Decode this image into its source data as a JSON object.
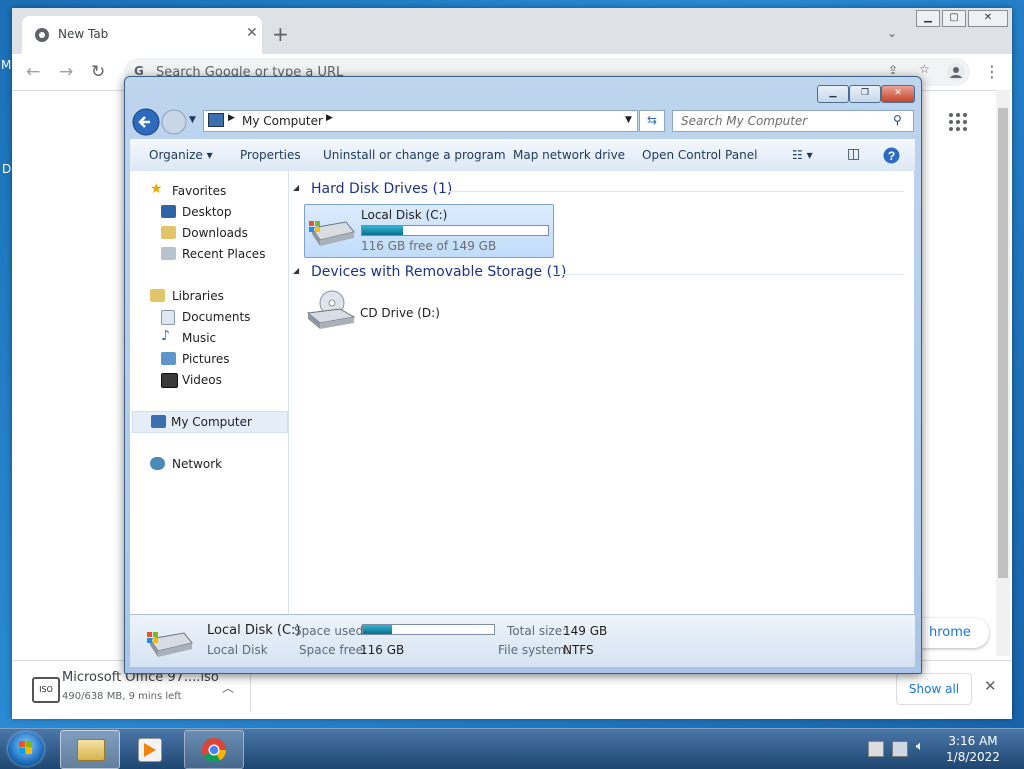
{
  "chrome": {
    "tab_title": "New Tab",
    "omnibox_placeholder": "Search Google or type a URL",
    "customize_label": "hrome"
  },
  "download": {
    "filename": "Microsoft Office 97....iso",
    "status": "490/638 MB, 9 mins left",
    "icon_text": "ISO",
    "show_all": "Show all"
  },
  "explorer": {
    "breadcrumb": "My Computer",
    "search_placeholder": "Search My Computer",
    "commands": [
      "Organize",
      "Properties",
      "Uninstall or change a program",
      "Map network drive",
      "Open Control Panel"
    ],
    "nav": {
      "favorites": "Favorites",
      "favorites_items": [
        "Desktop",
        "Downloads",
        "Recent Places"
      ],
      "libraries": "Libraries",
      "libraries_items": [
        "Documents",
        "Music",
        "Pictures",
        "Videos"
      ],
      "computer": "My Computer",
      "network": "Network"
    },
    "groups": {
      "hdd": "Hard Disk Drives (1)",
      "removable": "Devices with Removable Storage (1)"
    },
    "drive_c": {
      "name": "Local Disk (C:)",
      "free_text": "116 GB free of 149 GB",
      "used_fraction": 0.22
    },
    "drive_d": {
      "name": "CD Drive (D:)"
    },
    "details": {
      "name": "Local Disk (C:)",
      "type": "Local Disk",
      "space_used_label": "Space used:",
      "space_free_label": "Space free:",
      "space_free": "116 GB",
      "total_size_label": "Total size:",
      "total_size": "149 GB",
      "fs_label": "File system:",
      "fs": "NTFS",
      "used_fraction": 0.22
    }
  },
  "taskbar": {
    "time": "3:16 AM",
    "date": "1/8/2022"
  },
  "desktop_edge": {
    "m": "M",
    "d": "D"
  }
}
